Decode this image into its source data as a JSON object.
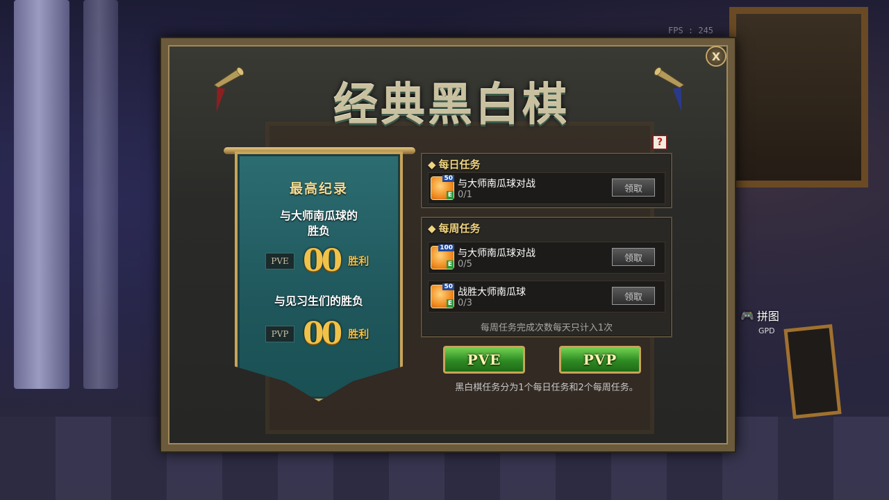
{
  "hud": {
    "fps": "FPS : 245",
    "puzzle_label": "拼图",
    "gpd_label": "GPD"
  },
  "panel": {
    "title": "经典黑白棋",
    "close_symbol": "X",
    "help_symbol": "?"
  },
  "record": {
    "title": "最高纪录",
    "pve_caption_line1": "与大师南瓜球的",
    "pve_caption_line2": "胜负",
    "pve_mode": "PVE",
    "pve_wins": "00",
    "pvp_caption": "与见习生们的胜负",
    "pvp_mode": "PVP",
    "pvp_wins": "00",
    "win_label": "胜利"
  },
  "daily": {
    "heading": "每日任务",
    "tasks": [
      {
        "reward_qty": "50",
        "name": "与大师南瓜球对战",
        "progress": "0/1",
        "claim": "领取"
      }
    ]
  },
  "weekly": {
    "heading": "每周任务",
    "tasks": [
      {
        "reward_qty": "100",
        "name": "与大师南瓜球对战",
        "progress": "0/5",
        "claim": "领取"
      },
      {
        "reward_qty": "50",
        "name": "战胜大师南瓜球",
        "progress": "0/3",
        "claim": "领取"
      }
    ],
    "note": "每周任务完成次数每天只计入1次"
  },
  "buttons": {
    "pve": "PVE",
    "pvp": "PVP"
  },
  "footer_note": "黑白棋任务分为1个每日任务和2个每周任务。",
  "colors": {
    "accent_gold": "#f0c24a",
    "banner_teal": "#2c6d72",
    "button_green": "#2e8a22"
  }
}
